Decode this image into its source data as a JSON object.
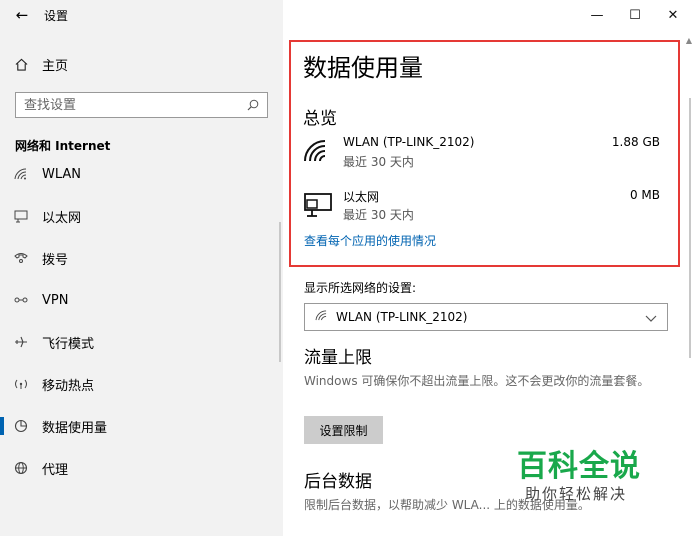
{
  "sidebar": {
    "back_icon": "arrow-left-icon",
    "title": "设置",
    "home": {
      "label": "主页",
      "icon": "home-icon"
    },
    "search": {
      "placeholder": "查找设置",
      "icon": "search-icon"
    },
    "section": "网络和 Internet",
    "items": [
      {
        "label": "WLAN",
        "icon": "wifi-icon"
      },
      {
        "label": "以太网",
        "icon": "ethernet-icon"
      },
      {
        "label": "拨号",
        "icon": "dialup-icon"
      },
      {
        "label": "VPN",
        "icon": "vpn-icon"
      },
      {
        "label": "飞行模式",
        "icon": "airplane-icon"
      },
      {
        "label": "移动热点",
        "icon": "hotspot-icon"
      },
      {
        "label": "数据使用量",
        "icon": "data-usage-icon",
        "active": true
      },
      {
        "label": "代理",
        "icon": "globe-icon"
      }
    ]
  },
  "window": {
    "minimize": "—",
    "maximize": "☐",
    "close": "✕"
  },
  "main": {
    "title": "数据使用量",
    "overview": "总览",
    "networks": [
      {
        "name": "WLAN (TP-LINK_2102)",
        "period": "最近 30 天内",
        "amount": "1.88 GB",
        "icon": "wifi-icon"
      },
      {
        "name": "以太网",
        "period": "最近 30 天内",
        "amount": "0 MB",
        "icon": "ethernet-icon"
      }
    ],
    "per_app_link": "查看每个应用的使用情况",
    "select_label": "显示所选网络的设置:",
    "select_value": "WLAN (TP-LINK_2102)",
    "limit_heading": "流量上限",
    "limit_desc": "Windows 可确保你不超出流量上限。这不会更改你的流量套餐。",
    "limit_button": "设置限制",
    "background_heading": "后台数据",
    "background_desc": "限制后台数据，以帮助减少 WLA... 上的数据使用量。"
  },
  "watermark": {
    "title": "百科全说",
    "subtitle": "助你轻松解决"
  },
  "colors": {
    "accent": "#0063b1",
    "highlight": "#e53935",
    "watermark": "#19a84b"
  }
}
